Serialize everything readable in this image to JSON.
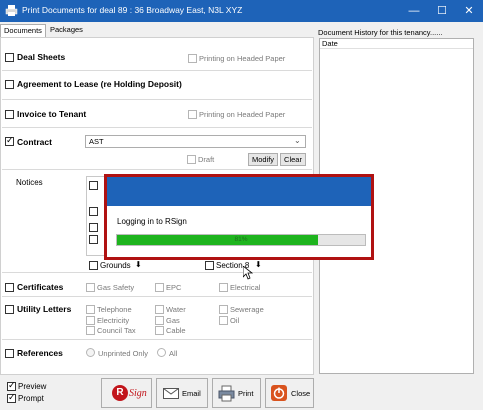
{
  "window": {
    "title": "Print Documents for deal 89 : 36 Broadway East, N3L XYZ",
    "min_symbol": "—",
    "max_symbol": "☐",
    "close_symbol": "✕",
    "icon": "printer-icon"
  },
  "tabs": [
    "Documents",
    "Packages"
  ],
  "documents": {
    "deal_sheets": {
      "label": "Deal Sheets",
      "checked": false,
      "headed_paper": "Printing on Headed Paper"
    },
    "agreement": {
      "label": "Agreement to Lease (re Holding Deposit)",
      "checked": false
    },
    "invoice": {
      "label": "Invoice to Tenant",
      "checked": false,
      "headed_paper": "Printing on Headed Paper"
    },
    "contract": {
      "label": "Contract",
      "checked": true,
      "value": "AST",
      "draft_label": "Draft",
      "modify_label": "Modify",
      "clear_label": "Clear"
    },
    "notices": {
      "label": "Notices",
      "grounds_label": "Grounds",
      "section8_label": "Section 8",
      "arrow": "⬇"
    },
    "certificates": {
      "label": "Certificates",
      "options": [
        "Gas Safety",
        "EPC",
        "Electrical"
      ]
    },
    "utility_letters": {
      "label": "Utility Letters",
      "col1": [
        "Telephone",
        "Electricity",
        "Council Tax"
      ],
      "col2": [
        "Water",
        "Gas",
        "Cable"
      ],
      "col3": [
        "Sewerage",
        "Oil"
      ]
    },
    "references": {
      "label": "References",
      "radio1": "Unprinted Only",
      "radio2": "All"
    }
  },
  "history": {
    "header": "Document History for this tenancy......",
    "column": "Date"
  },
  "footer": {
    "preview": {
      "label": "Preview",
      "checked": true
    },
    "prompt": {
      "label": "Prompt",
      "checked": true
    },
    "rsign_label": "Sign",
    "rsign_r": "R",
    "email_label": "Email",
    "print_label": "Print",
    "close_label": "Close"
  },
  "modal": {
    "message": "Logging in to RSign",
    "progress_text": "81%",
    "progress": 0.81
  },
  "colors": {
    "titlebar": "#1e63b8",
    "modal_border": "#b01212",
    "progress": "#1eb41e"
  }
}
